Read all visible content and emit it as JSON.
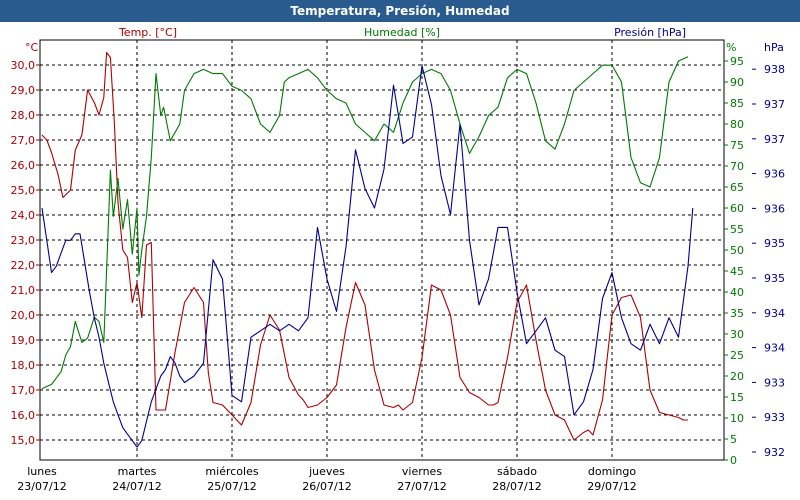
{
  "window_title": "Temperatura, Presión, Humedad",
  "colors": {
    "temp": "#b00000",
    "humidity": "#007a00",
    "pressure": "#000090",
    "titlebar": "#2a5b8f"
  },
  "chart_data": {
    "type": "line",
    "title": "Temperatura, Presión, Humedad",
    "grid": true,
    "x_labels": [
      {
        "day": "lunes",
        "date": "23/07/12"
      },
      {
        "day": "martes",
        "date": "24/07/12"
      },
      {
        "day": "miércoles",
        "date": "25/07/12"
      },
      {
        "day": "jueves",
        "date": "26/07/12"
      },
      {
        "day": "viernes",
        "date": "27/07/12"
      },
      {
        "day": "sábado",
        "date": "28/07/12"
      },
      {
        "day": "domingo",
        "date": "29/07/12"
      }
    ],
    "axes": {
      "temp": {
        "label": "Temp. [°C]",
        "unit": "°C",
        "ticks": [
          "15,0",
          "16,0",
          "17,0",
          "18,0",
          "19,0",
          "20,0",
          "21,0",
          "22,0",
          "23,0",
          "24,0",
          "25,0",
          "26,0",
          "27,0",
          "28,0",
          "29,0",
          "30,0"
        ],
        "range": [
          14.2,
          31.0
        ]
      },
      "humidity": {
        "label": "Humedad [%]",
        "unit": "%",
        "ticks": [
          "0",
          "5",
          "10",
          "15",
          "20",
          "25",
          "30",
          "35",
          "40",
          "45",
          "50",
          "55",
          "60",
          "65",
          "70",
          "75",
          "80",
          "85",
          "90",
          "95"
        ],
        "range": [
          0,
          100
        ]
      },
      "pressure": {
        "label": "Presión [hPa]",
        "unit": "hPa",
        "ticks": [
          "932",
          "933",
          "933",
          "934",
          "934",
          "935",
          "935",
          "936",
          "936",
          "937",
          "937",
          "938"
        ],
        "range": [
          932.0,
          938.5
        ]
      }
    },
    "series": [
      {
        "name": "Temp. [°C]",
        "axis": "temp",
        "x": [
          0,
          0.05,
          0.1,
          0.17,
          0.22,
          0.3,
          0.35,
          0.42,
          0.48,
          0.55,
          0.6,
          0.65,
          0.68,
          0.72,
          0.76,
          0.8,
          0.85,
          0.9,
          0.95,
          1.0,
          1.05,
          1.1,
          1.15,
          1.2,
          1.3,
          1.4,
          1.5,
          1.6,
          1.7,
          1.75,
          1.8,
          1.9,
          2.0,
          2.1,
          2.2,
          2.3,
          2.4,
          2.5,
          2.6,
          2.7,
          2.75,
          2.8,
          2.9,
          3.0,
          3.1,
          3.2,
          3.3,
          3.4,
          3.5,
          3.6,
          3.7,
          3.75,
          3.8,
          3.9,
          4.0,
          4.1,
          4.2,
          4.3,
          4.4,
          4.5,
          4.6,
          4.7,
          4.75,
          4.8,
          4.9,
          5.0,
          5.1,
          5.2,
          5.3,
          5.4,
          5.5,
          5.6,
          5.7,
          5.75,
          5.8,
          5.9,
          6.0,
          6.1,
          6.2,
          6.3,
          6.4,
          6.5,
          6.6,
          6.7,
          6.75,
          6.8
        ],
        "values": [
          27.2,
          27.0,
          26.5,
          25.6,
          24.7,
          25.0,
          26.6,
          27.2,
          29.0,
          28.5,
          28.0,
          28.7,
          30.5,
          30.3,
          27.8,
          24.5,
          22.6,
          22.3,
          20.5,
          21.3,
          19.9,
          22.8,
          22.9,
          16.2,
          16.2,
          18.5,
          20.5,
          21.1,
          20.5,
          17.7,
          16.5,
          16.4,
          16.0,
          15.6,
          16.5,
          18.8,
          20.0,
          19.4,
          17.5,
          16.8,
          16.6,
          16.3,
          16.4,
          16.7,
          17.2,
          19.5,
          21.3,
          20.4,
          17.8,
          16.4,
          16.3,
          16.4,
          16.2,
          16.5,
          18.3,
          21.2,
          21.0,
          20.0,
          17.5,
          16.9,
          16.7,
          16.4,
          16.4,
          16.5,
          18.3,
          20.5,
          21.2,
          19.0,
          17.0,
          16.0,
          15.8,
          15.0,
          15.3,
          15.4,
          15.2,
          16.6,
          20.0,
          20.7,
          20.8,
          19.9,
          17.0,
          16.1,
          16.0,
          15.9,
          15.8,
          15.8
        ]
      },
      {
        "name": "Humedad [%]",
        "axis": "humidity",
        "x": [
          0,
          0.1,
          0.2,
          0.25,
          0.3,
          0.35,
          0.42,
          0.48,
          0.55,
          0.6,
          0.65,
          0.7,
          0.72,
          0.75,
          0.8,
          0.85,
          0.9,
          0.95,
          1.0,
          1.02,
          1.05,
          1.1,
          1.15,
          1.2,
          1.22,
          1.25,
          1.28,
          1.35,
          1.45,
          1.5,
          1.6,
          1.7,
          1.8,
          1.9,
          2.0,
          2.1,
          2.2,
          2.3,
          2.4,
          2.5,
          2.55,
          2.6,
          2.7,
          2.8,
          2.9,
          3.0,
          3.1,
          3.2,
          3.3,
          3.4,
          3.5,
          3.6,
          3.7,
          3.8,
          3.9,
          4.0,
          4.1,
          4.2,
          4.3,
          4.4,
          4.5,
          4.6,
          4.7,
          4.8,
          4.9,
          5.0,
          5.1,
          5.2,
          5.3,
          5.4,
          5.5,
          5.6,
          5.7,
          5.8,
          5.9,
          6.0,
          6.1,
          6.2,
          6.3,
          6.4,
          6.5,
          6.6,
          6.7,
          6.8
        ],
        "values": [
          17,
          18,
          21,
          25,
          27,
          33,
          28,
          29,
          34,
          33,
          28,
          57,
          69,
          58,
          67,
          55,
          62,
          49,
          60,
          44,
          50,
          58,
          72,
          92,
          88,
          82,
          84,
          76,
          80,
          88,
          92,
          93,
          92,
          92,
          89,
          88,
          86,
          80,
          78,
          82,
          90,
          91,
          92,
          93,
          91,
          88,
          86,
          85,
          80,
          78,
          76,
          80,
          78,
          85,
          90,
          92,
          93,
          92,
          88,
          80,
          73,
          77,
          82,
          84,
          91,
          93,
          92,
          85,
          76,
          74,
          80,
          88,
          90,
          92,
          94,
          94,
          90,
          72,
          66,
          65,
          72,
          90,
          95,
          96
        ]
      },
      {
        "name": "Presión [hPa]",
        "axis": "pressure",
        "x": [
          0,
          0.05,
          0.1,
          0.15,
          0.2,
          0.25,
          0.3,
          0.35,
          0.4,
          0.5,
          0.55,
          0.6,
          0.65,
          0.7,
          0.75,
          0.8,
          0.85,
          0.9,
          0.95,
          1.0,
          1.05,
          1.1,
          1.15,
          1.2,
          1.25,
          1.3,
          1.35,
          1.4,
          1.45,
          1.5,
          1.6,
          1.7,
          1.8,
          1.9,
          2.0,
          2.1,
          2.2,
          2.3,
          2.4,
          2.5,
          2.6,
          2.7,
          2.8,
          2.9,
          3.0,
          3.1,
          3.2,
          3.3,
          3.4,
          3.5,
          3.6,
          3.7,
          3.8,
          3.9,
          4.0,
          4.1,
          4.2,
          4.3,
          4.4,
          4.5,
          4.6,
          4.7,
          4.8,
          4.9,
          5.0,
          5.1,
          5.2,
          5.3,
          5.4,
          5.5,
          5.6,
          5.7,
          5.8,
          5.9,
          6.0,
          6.1,
          6.2,
          6.3,
          6.4,
          6.5,
          6.6,
          6.7,
          6.8,
          6.85
        ],
        "values": [
          935.9,
          935.4,
          934.9,
          935.0,
          935.2,
          935.4,
          935.4,
          935.5,
          935.5,
          934.6,
          934.2,
          933.9,
          933.5,
          933.2,
          932.9,
          932.7,
          932.5,
          932.4,
          932.3,
          932.2,
          932.3,
          932.6,
          932.9,
          933.1,
          933.3,
          933.4,
          933.6,
          933.5,
          933.3,
          933.2,
          933.3,
          933.5,
          935.1,
          934.8,
          933.0,
          932.9,
          933.9,
          934.0,
          934.1,
          934.0,
          934.1,
          934.0,
          934.2,
          935.6,
          934.8,
          934.3,
          935.3,
          936.8,
          936.2,
          935.9,
          936.5,
          937.8,
          936.9,
          937.0,
          938.1,
          937.5,
          936.4,
          935.8,
          937.2,
          935.4,
          934.4,
          934.8,
          935.6,
          935.6,
          934.6,
          933.8,
          934.0,
          934.2,
          933.7,
          933.6,
          932.7,
          932.9,
          933.4,
          934.5,
          934.9,
          934.2,
          933.8,
          933.7,
          934.1,
          933.8,
          934.2,
          933.9,
          935.0,
          935.9
        ]
      }
    ]
  }
}
